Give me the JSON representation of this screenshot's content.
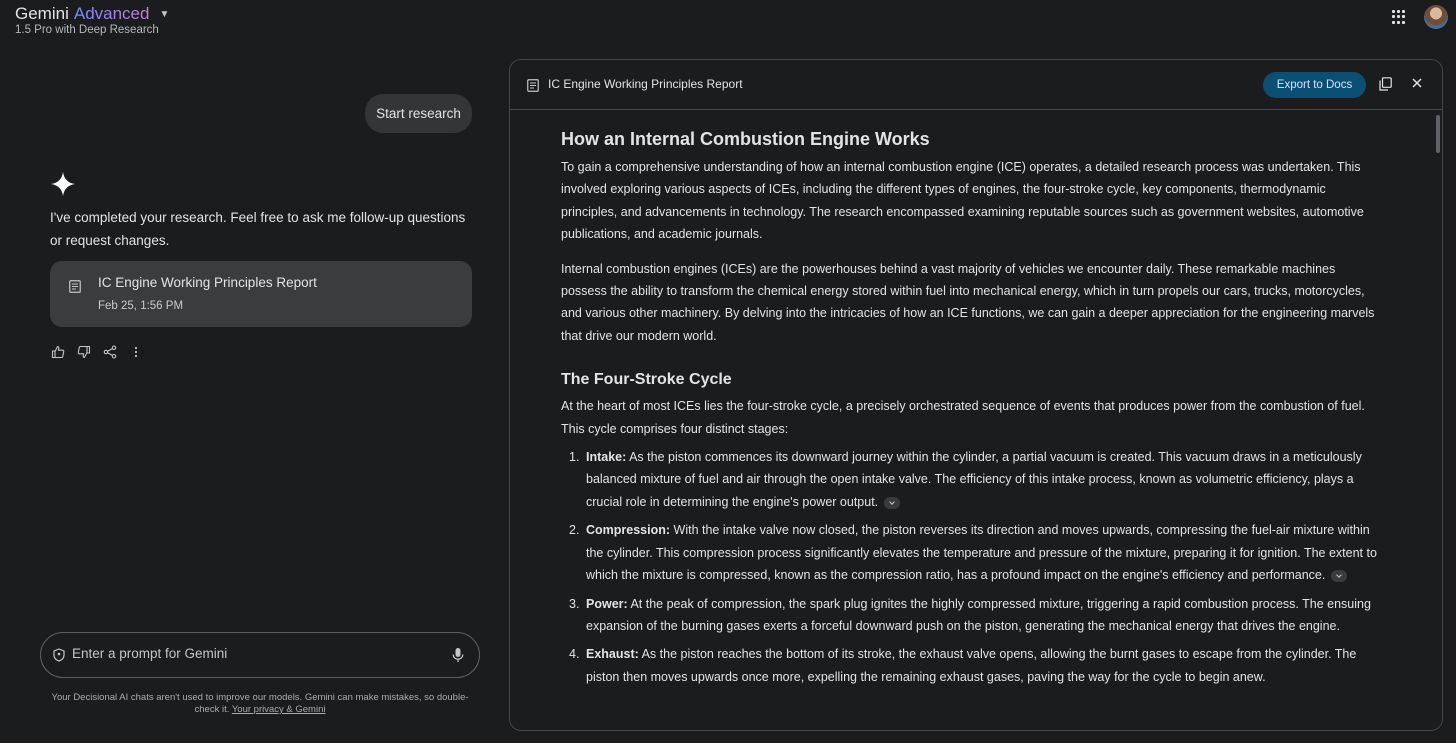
{
  "header": {
    "brand_main": "Gemini",
    "brand_advanced": "Advanced",
    "model": "1.5 Pro with Deep Research"
  },
  "chat": {
    "user_message": "Start research",
    "reply": "I've completed your research. Feel free to ask me follow-up questions or request changes.",
    "report_card": {
      "title": "IC Engine Working Principles Report",
      "date": "Feb 25, 1:56 PM"
    }
  },
  "prompt": {
    "placeholder": "Enter a prompt for Gemini",
    "disclaimer": "Your Decisional AI chats aren't used to improve our models. Gemini can make mistakes, so double-check it.",
    "privacy_link": "Your privacy & Gemini"
  },
  "panel": {
    "title": "IC Engine Working Principles Report",
    "export_label": "Export to Docs",
    "heading": "How an Internal Combustion Engine Works",
    "p1": "To gain a comprehensive understanding of how an internal combustion engine (ICE) operates, a detailed research process was undertaken. This involved exploring various aspects of ICEs, including the different types of engines, the four-stroke cycle, key components, thermodynamic principles, and advancements in technology. The research encompassed examining reputable sources such as government websites, automotive publications, and academic journals.",
    "p2": "Internal combustion engines (ICEs) are the powerhouses behind a vast majority of vehicles we encounter daily. These remarkable machines possess the ability to transform the chemical energy stored within fuel into mechanical energy, which in turn propels our cars, trucks, motorcycles, and various other machinery. By delving into the intricacies of how an ICE functions, we can gain a deeper appreciation for the engineering marvels that drive our modern world.",
    "section2_heading": "The Four-Stroke Cycle",
    "section2_intro": "At the heart of most ICEs lies the four-stroke cycle, a precisely orchestrated sequence of events that produces power from the combustion of fuel. This cycle comprises four distinct stages:",
    "strokes": [
      {
        "num": "1.",
        "term": "Intake:",
        "text": " As the piston commences its downward journey within the cylinder, a partial vacuum is created. This vacuum draws in a meticulously balanced mixture of fuel and air through the open intake valve. The efficiency of this intake process, known as volumetric efficiency, plays a crucial role in determining the engine's power output."
      },
      {
        "num": "2.",
        "term": "Compression:",
        "text": " With the intake valve now closed, the piston reverses its direction and moves upwards, compressing the fuel-air mixture within the cylinder. This compression process significantly elevates the temperature and pressure of the mixture, preparing it for ignition. The extent to which the mixture is compressed, known as the compression ratio, has a profound impact on the engine's efficiency and performance."
      },
      {
        "num": "3.",
        "term": "Power:",
        "text": " At the peak of compression, the spark plug ignites the highly compressed mixture, triggering a rapid combustion process. The ensuing expansion of the burning gases exerts a forceful downward push on the piston, generating the mechanical energy that drives the engine."
      },
      {
        "num": "4.",
        "term": "Exhaust:",
        "text": " As the piston reaches the bottom of its stroke, the exhaust valve opens, allowing the burnt gases to escape from the cylinder. The piston then moves upwards once more, expelling the remaining exhaust gases, paving the way for the cycle to begin anew."
      }
    ]
  }
}
